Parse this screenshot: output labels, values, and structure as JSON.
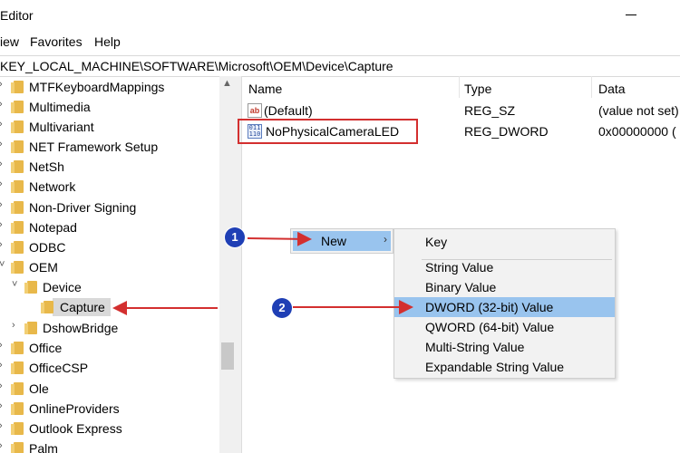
{
  "window": {
    "title": "Editor"
  },
  "menu": [
    "iew",
    "Favorites",
    "Help"
  ],
  "address": "KEY_LOCAL_MACHINE\\SOFTWARE\\Microsoft\\OEM\\Device\\Capture",
  "tree": [
    {
      "label": "MTFKeyboardMappings"
    },
    {
      "label": "Multimedia"
    },
    {
      "label": "Multivariant"
    },
    {
      "label": "NET Framework Setup"
    },
    {
      "label": "NetSh"
    },
    {
      "label": "Network"
    },
    {
      "label": "Non-Driver Signing"
    },
    {
      "label": "Notepad"
    },
    {
      "label": "ODBC"
    },
    {
      "label": "OEM"
    },
    {
      "label": "Device"
    },
    {
      "label": "Capture"
    },
    {
      "label": "DshowBridge"
    },
    {
      "label": "Office"
    },
    {
      "label": "OfficeCSP"
    },
    {
      "label": "Ole"
    },
    {
      "label": "OnlineProviders"
    },
    {
      "label": "Outlook Express"
    },
    {
      "label": "Palm"
    }
  ],
  "columns": {
    "name": "Name",
    "type": "Type",
    "data": "Data"
  },
  "values": [
    {
      "name": "(Default)",
      "type": "REG_SZ",
      "data": "(value not set)",
      "icon": "string-value-icon"
    },
    {
      "name": "NoPhysicalCameraLED",
      "type": "REG_DWORD",
      "data": "0x00000000 (",
      "icon": "binary-value-icon"
    }
  ],
  "context_menu": {
    "new_label": "New"
  },
  "submenu": {
    "key": "Key",
    "items": [
      "String Value",
      "Binary Value",
      "DWORD (32-bit) Value",
      "QWORD (64-bit) Value",
      "Multi-String Value",
      "Expandable String Value"
    ]
  },
  "annotations": {
    "badge1": "1",
    "badge2": "2",
    "accent": "#d32f2f",
    "badge_color": "#1f3fb5"
  }
}
